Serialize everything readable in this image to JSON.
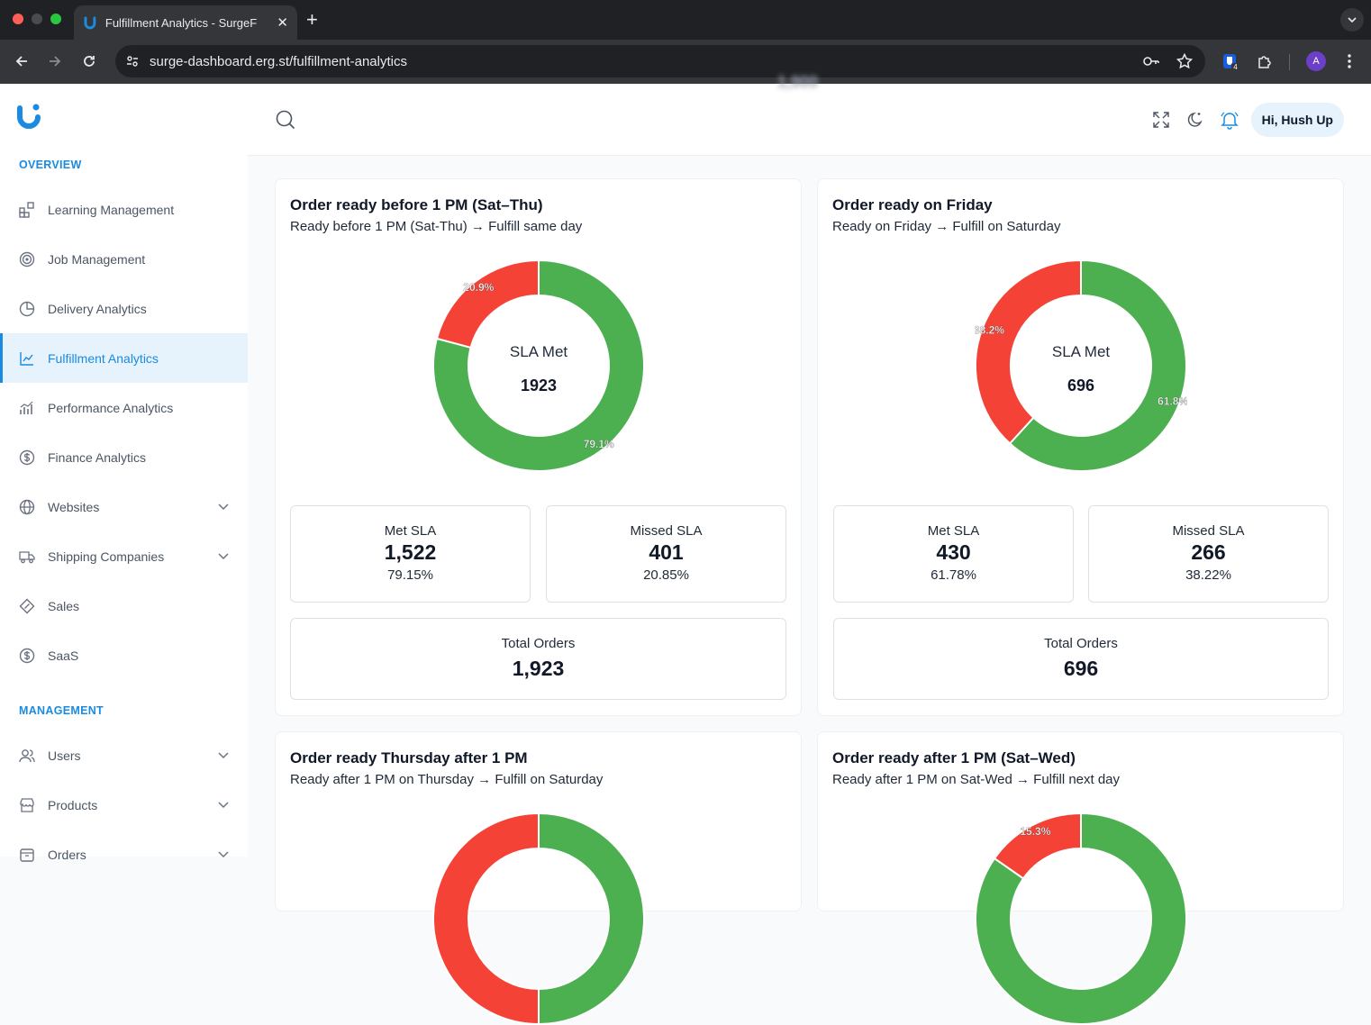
{
  "browser": {
    "tab_title": "Fulfillment Analytics - SurgeF",
    "url": "surge-dashboard.erg.st/fulfillment-analytics",
    "extension_badge": "4",
    "profile_initial": "A"
  },
  "sidebar": {
    "overview_title": "OVERVIEW",
    "management_title": "MANAGEMENT",
    "items": [
      {
        "label": "Learning Management",
        "icon": "blocks-icon"
      },
      {
        "label": "Job Management",
        "icon": "target-icon"
      },
      {
        "label": "Delivery Analytics",
        "icon": "pie-icon"
      },
      {
        "label": "Fulfillment Analytics",
        "icon": "chart-line-icon",
        "active": true
      },
      {
        "label": "Performance Analytics",
        "icon": "bar-chart-icon"
      },
      {
        "label": "Finance Analytics",
        "icon": "dollar-circle-icon"
      },
      {
        "label": "Websites",
        "icon": "globe-icon",
        "expandable": true
      },
      {
        "label": "Shipping Companies",
        "icon": "truck-icon",
        "expandable": true
      },
      {
        "label": "Sales",
        "icon": "tag-icon"
      },
      {
        "label": "SaaS",
        "icon": "dollar-circle-icon"
      }
    ],
    "management_items": [
      {
        "label": "Users",
        "icon": "users-icon",
        "expandable": true
      },
      {
        "label": "Products",
        "icon": "store-icon",
        "expandable": true
      },
      {
        "label": "Orders",
        "icon": "box-icon",
        "expandable": true
      }
    ]
  },
  "header": {
    "greeting": "Hi, Hush Up",
    "ghost_value": "1,900"
  },
  "colors": {
    "met": "#4caf50",
    "missed": "#f44336",
    "accent": "#1a8be0"
  },
  "cards": [
    {
      "title": "Order ready before 1 PM (Sat–Thu)",
      "subtitle": "Ready before 1 PM (Sat-Thu) → Fulfill same day",
      "center_label": "SLA Met",
      "center_value": "1923",
      "met_label": "Met SLA",
      "met_value": "1,522",
      "met_pct": "79.15%",
      "missed_label": "Missed SLA",
      "missed_value": "401",
      "missed_pct": "20.85%",
      "total_label": "Total Orders",
      "total_value": "1,923"
    },
    {
      "title": "Order ready on Friday",
      "subtitle": "Ready on Friday → Fulfill on Saturday",
      "center_label": "SLA Met",
      "center_value": "696",
      "met_label": "Met SLA",
      "met_value": "430",
      "met_pct": "61.78%",
      "missed_label": "Missed SLA",
      "missed_value": "266",
      "missed_pct": "38.22%",
      "total_label": "Total Orders",
      "total_value": "696"
    },
    {
      "title": "Order ready Thursday after 1 PM",
      "subtitle": "Ready after 1 PM on Thursday → Fulfill on Saturday"
    },
    {
      "title": "Order ready after 1 PM (Sat–Wed)",
      "subtitle": "Ready after 1 PM on Sat-Wed → Fulfill next day"
    }
  ],
  "chart_data": [
    {
      "type": "pie",
      "title": "Order ready before 1 PM (Sat–Thu)",
      "categories": [
        "Met SLA",
        "Missed SLA"
      ],
      "values": [
        1522,
        401
      ],
      "labels": [
        "79.1%",
        "20.9%"
      ]
    },
    {
      "type": "pie",
      "title": "Order ready on Friday",
      "categories": [
        "Met SLA",
        "Missed SLA"
      ],
      "values": [
        430,
        266
      ],
      "labels": [
        "61.8%",
        "38.2%"
      ]
    },
    {
      "type": "pie",
      "title": "Order ready Thursday after 1 PM",
      "categories": [
        "Met SLA",
        "Missed SLA"
      ],
      "values": [
        50,
        50
      ],
      "labels": [
        "",
        ""
      ]
    },
    {
      "type": "pie",
      "title": "Order ready after 1 PM (Sat–Wed)",
      "categories": [
        "Met SLA",
        "Missed SLA"
      ],
      "values": [
        84.7,
        15.3
      ],
      "labels": [
        "",
        "15.3%"
      ]
    }
  ]
}
